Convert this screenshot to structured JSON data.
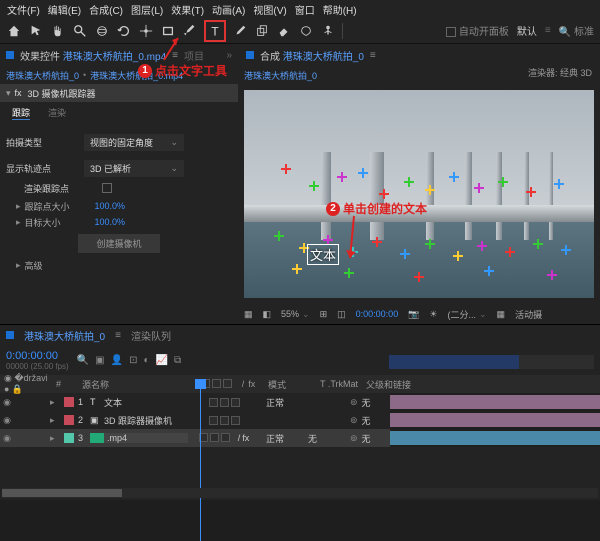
{
  "menu": {
    "file": "文件(F)",
    "edit": "编辑(E)",
    "comp": "合成(C)",
    "layer": "图层(L)",
    "effect": "效果(T)",
    "anim": "动画(A)",
    "view": "视图(V)",
    "window": "窗口",
    "help": "帮助(H)"
  },
  "toolbar": {
    "auto_open": "自动开面板",
    "workspace": "默认",
    "search": "标准"
  },
  "annotations": {
    "a1": "点击文字工具",
    "a2": "单击创建的文本"
  },
  "effect_panel": {
    "tab_prefix": "效果控件",
    "clip": "港珠澳大桥航拍_0.mp4",
    "project_tab": "项目",
    "breadcrumb_a": "港珠澳大桥航拍_0",
    "breadcrumb_b": "港珠澳大桥航拍_0.mp4",
    "section": "3D 摄像机跟踪器",
    "tab1": "跟踪",
    "tab2": "渲染",
    "rows": {
      "shot_type_label": "拍摄类型",
      "shot_type_value": "视图的固定角度",
      "show_label": "显示轨迹点",
      "solve_label": "3D 已解析",
      "render_label": "渲染跟踪点",
      "size_label": "跟踪点大小",
      "size_value": "100.0%",
      "target_label": "目标大小",
      "target_value": "100.0%",
      "create_cam": "创建摄像机",
      "advanced": "高级"
    }
  },
  "comp_panel": {
    "tab_prefix": "合成",
    "comp_name": "港珠澳大桥航拍_0",
    "renderer_label": "渲染器:",
    "renderer_value": "经典 3D",
    "text_layer": "文本",
    "footer": {
      "zoom": "55%",
      "res": "(二分...",
      "time": "0:00:00:00",
      "active": "活动摄"
    }
  },
  "timeline": {
    "tab": "港珠澳大桥航拍_0",
    "render_queue": "渲染队列",
    "timecode": "0:00:00:00",
    "frame_info": "00000 (25.00 fps)",
    "columns": {
      "source": "源名称",
      "mode": "模式",
      "trkmat": "T .TrkMat",
      "parent": "父级和链接"
    },
    "layers": [
      {
        "idx": "1",
        "color": "#c74a5a",
        "icon": "T",
        "name": "文本",
        "mode": "正常",
        "trk": "",
        "parent": "无"
      },
      {
        "idx": "2",
        "color": "#c74a5a",
        "icon": "▦",
        "name": "3D 跟踪器摄像机",
        "mode": "",
        "trk": "",
        "parent": "无"
      },
      {
        "idx": "3",
        "color": "#53c7a9",
        "icon": "▶",
        "name": ".mp4",
        "mode": "正常",
        "trk": "无",
        "parent": "无"
      }
    ],
    "none": "无",
    "fx": "fx",
    "normal": "正常"
  },
  "chart_data": null
}
